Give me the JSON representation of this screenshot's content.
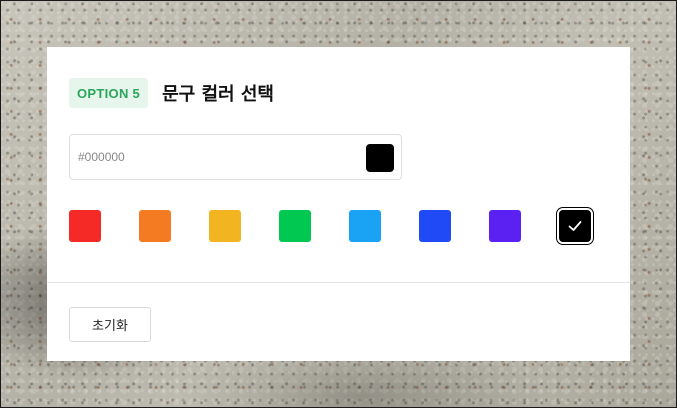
{
  "header": {
    "badge": "OPTION 5",
    "title": "문구 컬러 선택"
  },
  "hex_input": {
    "placeholder": "#000000",
    "value": "",
    "current_color": "#000000"
  },
  "swatches": [
    {
      "name": "red",
      "color": "#f52a26"
    },
    {
      "name": "orange",
      "color": "#f47b21"
    },
    {
      "name": "yellow",
      "color": "#f2b521"
    },
    {
      "name": "green",
      "color": "#00c851"
    },
    {
      "name": "sky-blue",
      "color": "#1aa3f5"
    },
    {
      "name": "blue",
      "color": "#1f4af5"
    },
    {
      "name": "purple",
      "color": "#5b21f2"
    },
    {
      "name": "black",
      "color": "#000000",
      "selected": true,
      "icon": "check-icon"
    }
  ],
  "actions": {
    "reset_label": "초기화"
  },
  "colors": {
    "badge_bg": "#e7f6ed",
    "badge_text": "#2aa55a"
  }
}
